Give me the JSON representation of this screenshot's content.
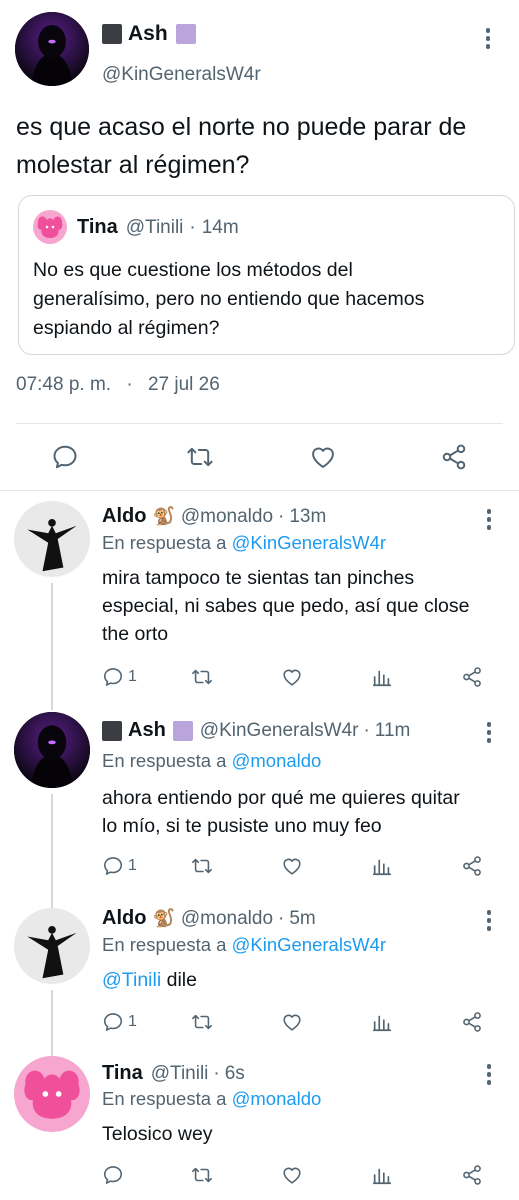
{
  "main_tweet": {
    "author": {
      "name": "Ash",
      "handle": "@KinGeneralsW4r"
    },
    "text_line1": "es que acaso el norte no puede parar de",
    "text_line2": "molestar al régimen?",
    "quote": {
      "author": {
        "name": "Tina",
        "handle": "@Tinili",
        "time": "14m"
      },
      "text_line1": "No es que cuestione los métodos del",
      "text_line2": "generalísimo, pero no entiendo que hacemos",
      "text_line3": "espiando al régimen?"
    },
    "time": "07:48 p. m.",
    "separator": "·",
    "date": "27 jul 26"
  },
  "reply_prefix": "En respuesta a",
  "replies": [
    {
      "name": "Aldo",
      "emoji": "🐒",
      "handle": "@monaldo",
      "time": "13m",
      "reply_to": "@KinGeneralsW4r",
      "text_line1": "mira tampoco te sientas tan pinches",
      "text_line2": "especial, ni sabes que pedo, así que close",
      "text_line3": "the orto",
      "reply_count": "1"
    },
    {
      "name": "Ash",
      "handle": "@KinGeneralsW4r",
      "time": "11m",
      "reply_to": "@monaldo",
      "text_line1": "ahora entiendo por qué me quieres quitar",
      "text_line2": "lo mío, si te pusiste uno muy feo",
      "reply_count": "1"
    },
    {
      "name": "Aldo",
      "emoji": "🐒",
      "handle": "@monaldo",
      "time": "5m",
      "reply_to": "@KinGeneralsW4r",
      "mention": "@Tinili",
      "text": "dile",
      "reply_count": "1"
    },
    {
      "name": "Tina",
      "handle": "@Tinili",
      "time": "6s",
      "reply_to": "@monaldo",
      "text": "Telosico wey"
    }
  ],
  "colors": {
    "accent": "#1d9bf0",
    "text": "#0f1419",
    "secondary": "#536471",
    "border": "#cfd9de",
    "ash_square_dark": "#3a3d42",
    "ash_square_purple": "#b9a4dc",
    "tina_avatar": "#f27fb8"
  },
  "icons": [
    "reply-icon",
    "retweet-icon",
    "like-icon",
    "share-icon",
    "views-icon",
    "more-icon"
  ]
}
